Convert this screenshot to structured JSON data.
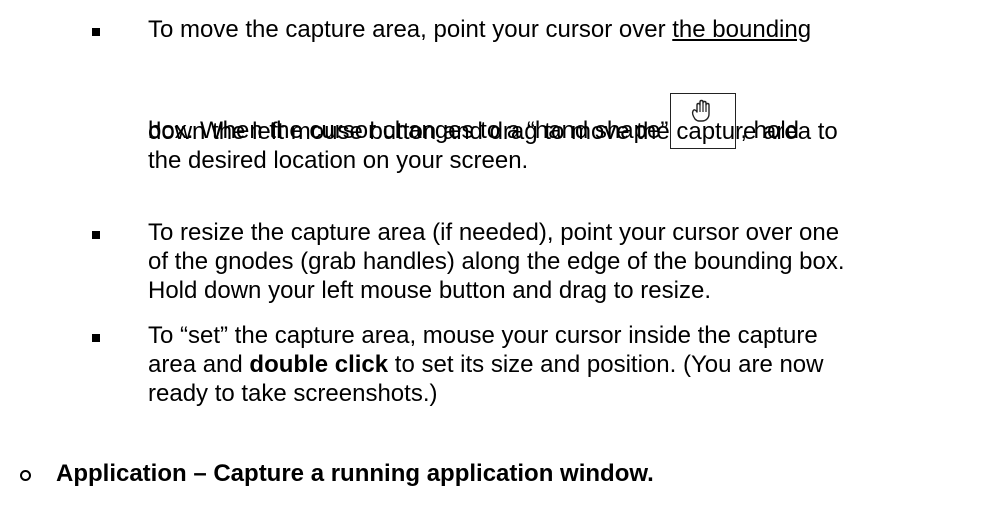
{
  "bullets": [
    {
      "lines": [
        {
          "pre": "To move the capture area, point your cursor over ",
          "underlined": "the bounding"
        },
        {
          "pre": "box. When the cursor changes to a “hand shape”",
          "icon": "hand-cursor-icon",
          "post": ", hold"
        },
        {
          "text": "down the left mouse button and drag to move the capture area to"
        },
        {
          "text": "the desired location on your screen."
        }
      ]
    },
    {
      "lines": [
        {
          "text": "To resize the capture area (if needed), point your cursor over one"
        },
        {
          "text": "of the gnodes (grab handles) along the edge of the bounding box."
        },
        {
          "text": "Hold down your left mouse button and drag to resize."
        }
      ]
    },
    {
      "lines": [
        {
          "text": "To “set” the capture area, mouse your cursor inside the capture"
        },
        {
          "pre": "area and ",
          "bold": "double click",
          "post": " to set its size and position. (You are now"
        },
        {
          "text": "ready to take screenshots.)"
        }
      ]
    }
  ],
  "sub_item": {
    "text": "Application – Capture a running application window."
  }
}
